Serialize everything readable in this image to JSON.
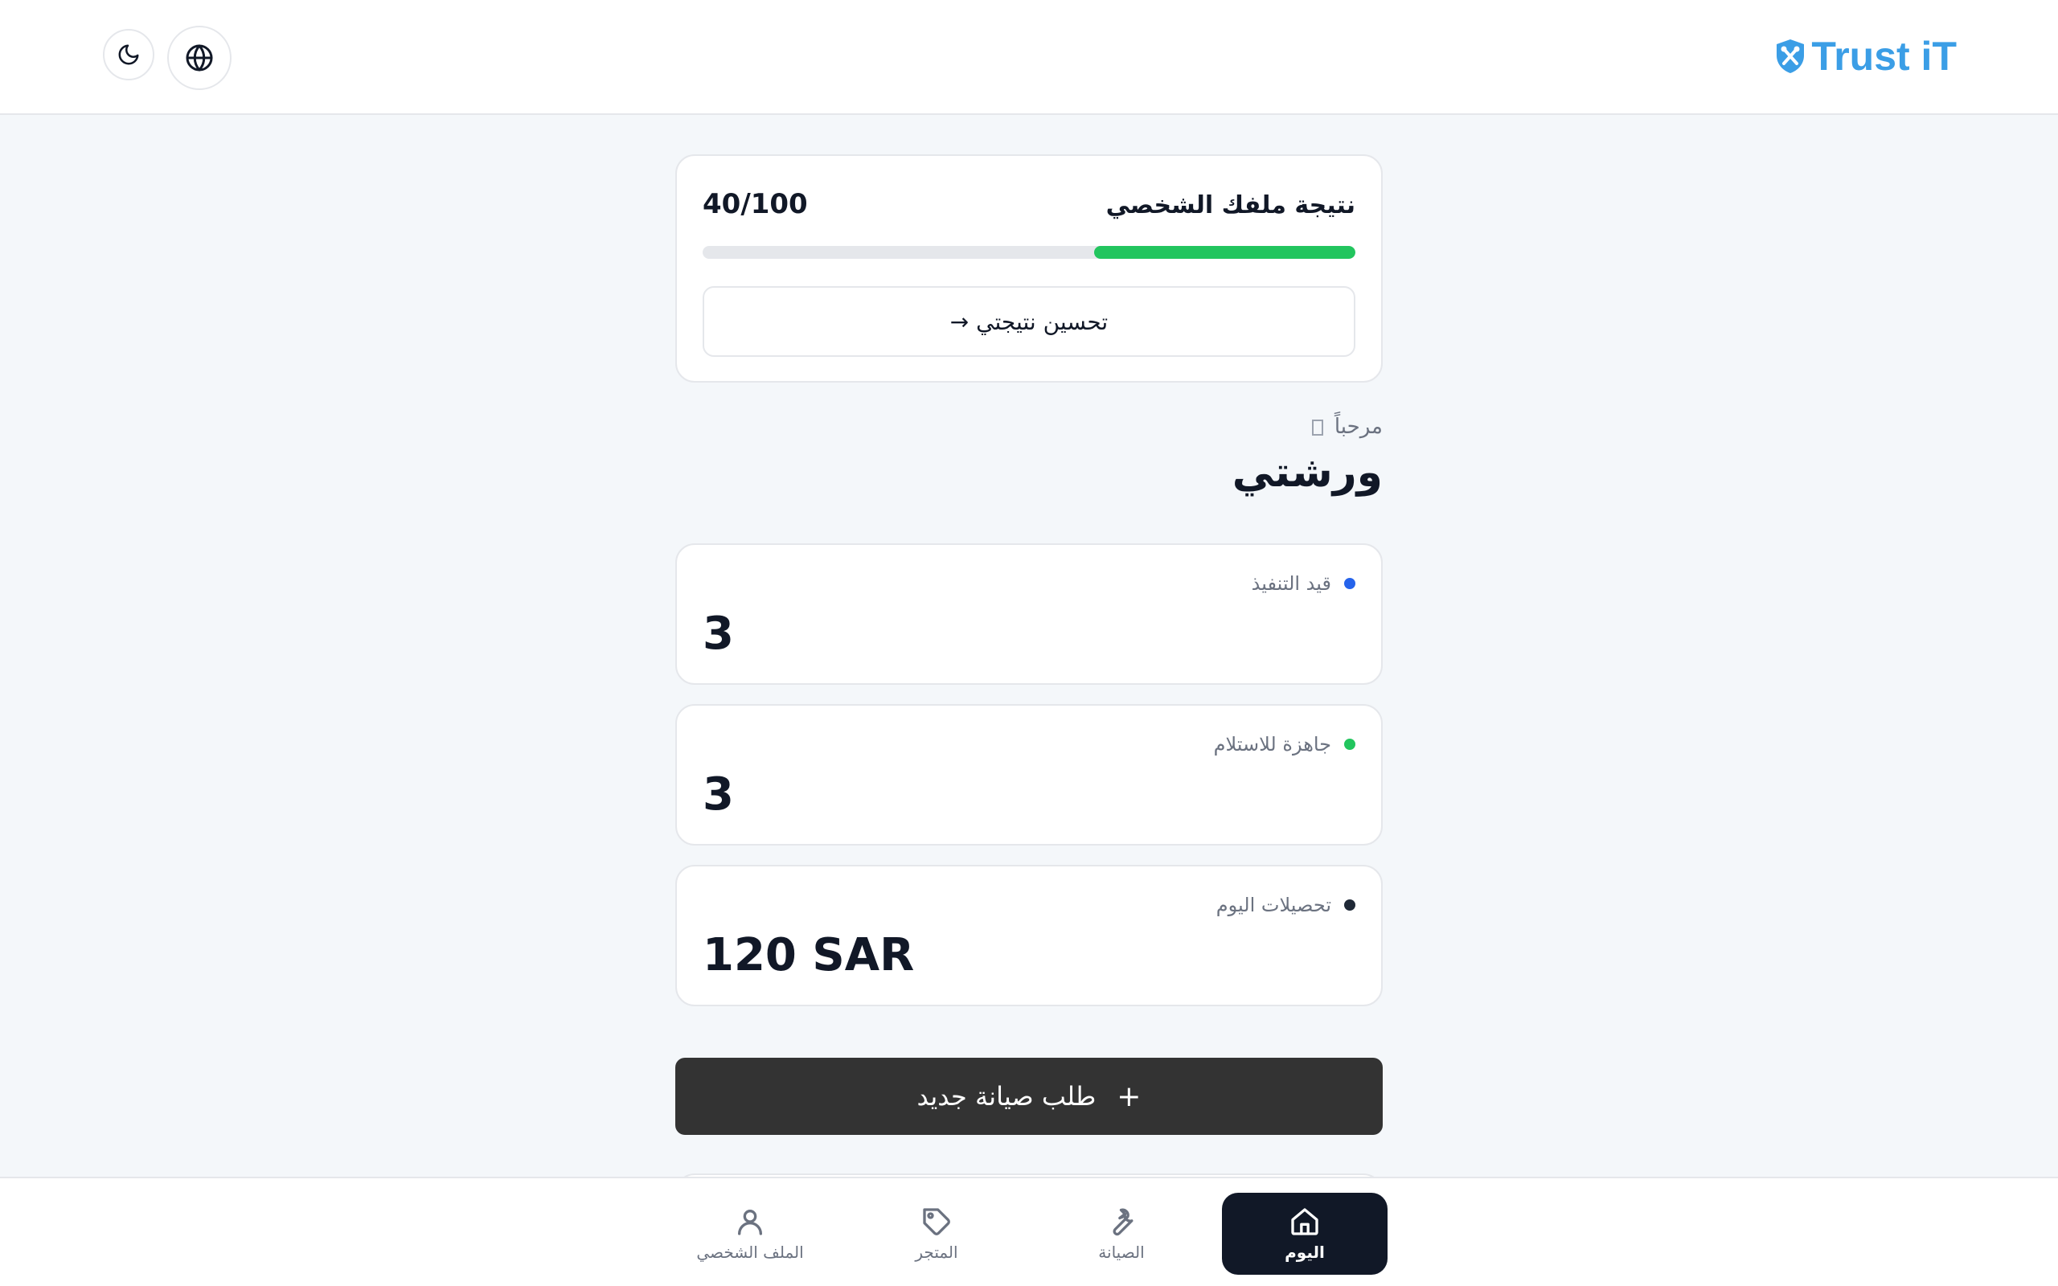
{
  "header": {
    "logo_text": "Trust iT",
    "theme_icon": "moon-icon",
    "language_icon": "globe-icon",
    "brand_color": "#3b9ee6"
  },
  "score_card": {
    "title": "نتيجة ملفك الشخصي",
    "value_text": "40/100",
    "progress": 0.4,
    "progress_color": "#22c55e",
    "improve_label": "تحسين نتيجتي →"
  },
  "welcome": {
    "greeting": "مرحباً",
    "workshop_name": "ورشتي"
  },
  "stats": [
    {
      "label": "قيد التنفيذ",
      "value": "3",
      "dot_color": "#2563eb"
    },
    {
      "label": "جاهزة للاستلام",
      "value": "3",
      "dot_color": "#22c55e"
    },
    {
      "label": "تحصيلات اليوم",
      "value": "120 SAR",
      "dot_color": "#1f2937"
    }
  ],
  "new_request": {
    "label": "طلب صيانة جديد",
    "icon": "plus-icon"
  },
  "bottom_nav": {
    "items": [
      {
        "label": "اليوم",
        "icon": "home-icon",
        "active": true
      },
      {
        "label": "الصيانة",
        "icon": "wrench-icon",
        "active": false
      },
      {
        "label": "المتجر",
        "icon": "tag-icon",
        "active": false
      },
      {
        "label": "الملف الشخصي",
        "icon": "user-icon",
        "active": false
      }
    ]
  }
}
